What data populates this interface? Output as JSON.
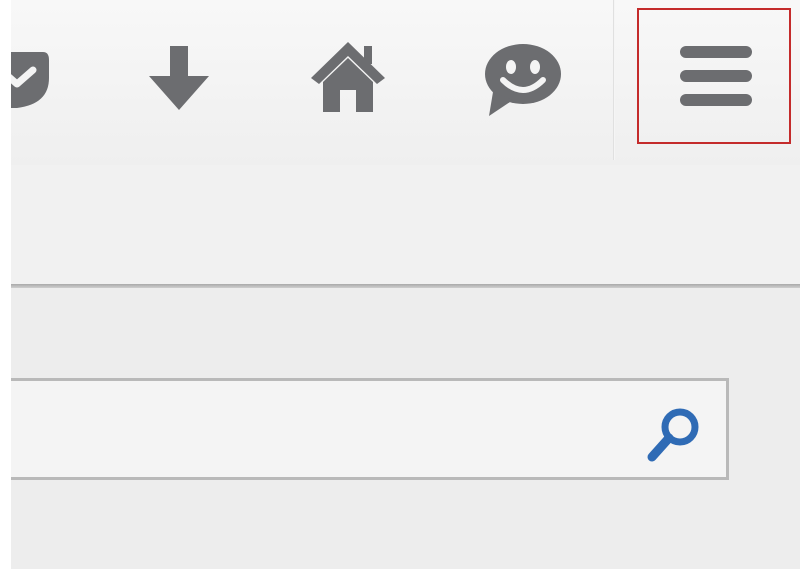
{
  "toolbar": {
    "buttons": [
      {
        "id": "pocket",
        "icon": "pocket-icon"
      },
      {
        "id": "download",
        "icon": "download-arrow-icon"
      },
      {
        "id": "home",
        "icon": "home-icon"
      },
      {
        "id": "chat",
        "icon": "speech-bubble-smiley-icon"
      }
    ],
    "menu_button": {
      "icon": "hamburger-menu-icon",
      "highlight_color": "#c42b2b"
    }
  },
  "search": {
    "value": "",
    "placeholder": "",
    "icon": "magnifier-icon",
    "icon_color": "#2f6bb5"
  },
  "colors": {
    "icon_gray": "#6c6d70",
    "chrome_background": "#f1f1f1",
    "highlight": "#c42b2b"
  }
}
